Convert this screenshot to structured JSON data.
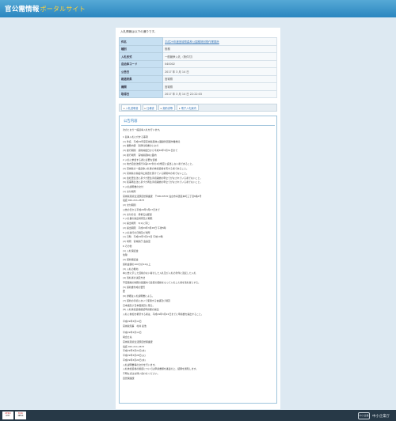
{
  "header": {
    "title": "官公需情報",
    "subtitle": "ポータルサイト"
  },
  "intro": "入札情報は以下の通りです。",
  "info_rows": [
    {
      "label": "件名",
      "value": "平成29年度宮城県森林公園樹勢回復作業委託"
    },
    {
      "label": "種別",
      "value": "役務"
    },
    {
      "label": "入札形式",
      "value": "一般競争入札（条件付）"
    },
    {
      "label": "自治体コード",
      "value": "040002"
    },
    {
      "label": "公告日",
      "value": "2017 年 3 月 14 日"
    },
    {
      "label": "都道府県",
      "value": "宮城県"
    },
    {
      "label": "機関",
      "value": "宮城県"
    },
    {
      "label": "取得日",
      "value": "2017 年 3 月 14 日 22:22:03"
    }
  ],
  "tabs": [
    "入札説明書",
    "仕様書",
    "契約書等",
    "電子入札案内"
  ],
  "notice": {
    "title": "公告内容",
    "lines": [
      "次のとおり一般競争入札を行います。",
      "",
      "1 競争入札に付する事項",
      "(1) 件名　平成29年度宮城県森林公園樹勢回復作業委託",
      "(2) 業務内容　別添仕様書のとおり",
      "(3) 履行期間　契約締結日から平成30年3月31日まで",
      "(4) 履行場所　宮城県森林公園内",
      "2 入札に参加する者に必要な資格",
      "(1) 地方自治法施行令第167条の4の規定に該当しない者であること。",
      "(2) 宮城県の一般競争入札等の参加資格を有する者であること。",
      "(3) 宮城県の指名停止措置を受けている期間中の者でないこと。",
      "(4) 会社更生法に基づき更生手続開始の申立てがなされている者でないこと。",
      "(5) 民事再生法に基づき再生手続開始の申立てがなされている者でないこと。",
      "3 入札説明書の交付",
      "(1) 交付場所",
      "宮城県環境生活部自然保護課　〒980-8570 仙台市青葉区本町三丁目8番1号",
      "電話 022-211-2673",
      "(2) 交付期間",
      "公告の日から平成29年3月27日まで",
      "(3) 交付方法　持参又は郵送",
      "4 入札書の提出場所及び期限",
      "(1) 提出場所　3(1)に同じ",
      "(2) 提出期限　平成29年3月28日 午後5時",
      "5 入札執行の日時及び場所",
      "(1) 日時　平成29年3月29日 午前10時",
      "(2) 場所　宮城県庁 会議室",
      "6 その他",
      "(1) 入札保証金",
      "免除",
      "(2) 契約保証金",
      "契約金額の100分の10以上",
      "(3) 入札の無効",
      "本公告に示した資格のない者のした入札及び入札の条件に違反した入札",
      "(4) 落札者の決定方法",
      "予定価格の制限の範囲内で最低の価格をもって入札した者を落札者とする。",
      "(5) 契約書作成の要否",
      "要",
      "(6) 詳細は入札説明書による。",
      "(7) 契約の手続において使用する言語及び通貨",
      "日本語及び日本国通貨に限る。",
      "(8) 入札参加資格確認申請書の提出",
      "入札に参加を希望する者は、平成29年3月22日までに申請書を提出すること。",
      "",
      "平成29年3月14日",
      "宮城県知事　村井 嘉浩",
      "",
      "平成29年3月14日",
      "問合せ先",
      "宮城県環境生活部自然保護課",
      "電話 022-211-2673",
      "平成29年3月22日(水)",
      "平成29年3月28日(火)",
      "平成29年3月29日(水)",
      "入札説明書等の交付を行います。",
      "入札参加資格の確認については申請書類を審査の上、結果を通知します。",
      "不明な点はお問い合わせください。",
      "自然保護課"
    ]
  },
  "footer": {
    "badges": [
      [
        "ZERO",
        "NTY"
      ],
      [
        "BUSI",
        "NESS"
      ]
    ],
    "mark": "中小企業",
    "agency": "中小企業庁"
  }
}
